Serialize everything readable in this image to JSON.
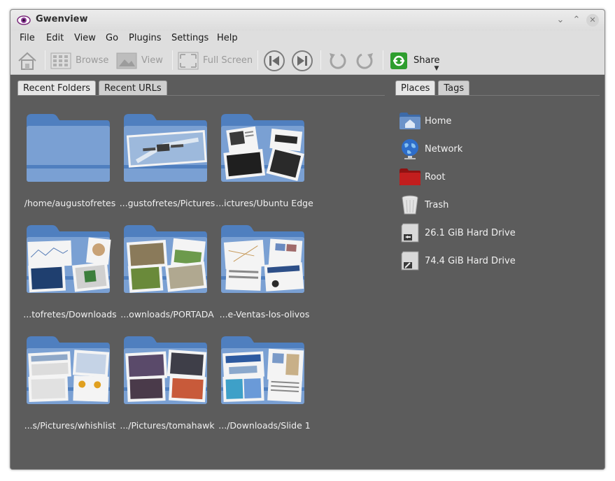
{
  "window": {
    "title": "Gwenview"
  },
  "menu": [
    "File",
    "Edit",
    "View",
    "Go",
    "Plugins",
    "Settings",
    "Help"
  ],
  "toolbar": {
    "browse": "Browse",
    "view": "View",
    "fullscreen": "Full Screen",
    "share": "Share"
  },
  "left_tabs": [
    "Recent Folders",
    "Recent URLs"
  ],
  "right_tabs": [
    "Places",
    "Tags"
  ],
  "folders": [
    {
      "label": "/home/augustofretes"
    },
    {
      "label": "...gustofretes/Pictures"
    },
    {
      "label": "...ictures/Ubuntu Edge"
    },
    {
      "label": "...tofretes/Downloads"
    },
    {
      "label": "...ownloads/PORTADA"
    },
    {
      "label": "...e-Ventas-los-olivos"
    },
    {
      "label": "...s/Pictures/whishlist"
    },
    {
      "label": ".../Pictures/tomahawk"
    },
    {
      "label": ".../Downloads/Slide 1"
    }
  ],
  "places": [
    {
      "label": "Home",
      "icon": "home-folder-icon"
    },
    {
      "label": "Network",
      "icon": "network-globe-icon"
    },
    {
      "label": "Root",
      "icon": "root-folder-icon"
    },
    {
      "label": "Trash",
      "icon": "trash-icon"
    },
    {
      "label": "26.1 GiB Hard Drive",
      "icon": "hard-drive-icon"
    },
    {
      "label": "74.4 GiB Hard Drive",
      "icon": "hard-drive-icon"
    }
  ],
  "colors": {
    "folder_blue": "#6c93c9",
    "panel_bg": "#5c5c5c",
    "chrome": "#dedede",
    "share_green": "#2e9e2e"
  }
}
